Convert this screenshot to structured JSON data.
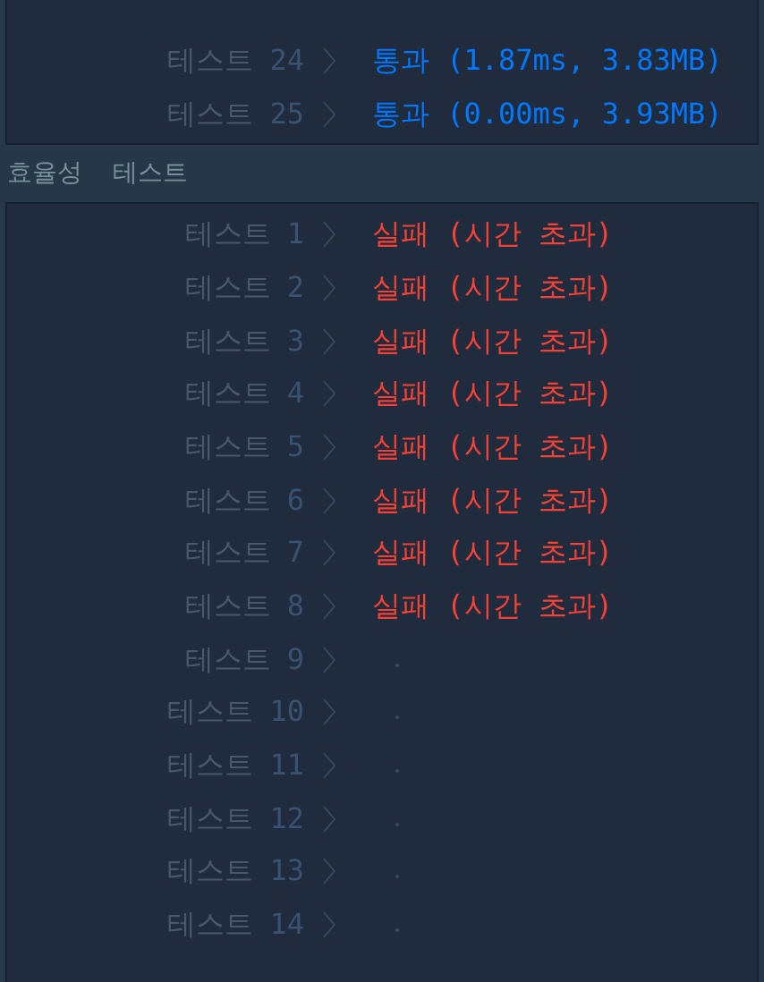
{
  "sections": [
    {
      "tests": [
        {
          "label": "테스트",
          "number": "24",
          "kind": "pass",
          "result": "통과 (1.87ms, 3.83MB)"
        },
        {
          "label": "테스트",
          "number": "25",
          "kind": "pass",
          "result": "통과 (0.00ms, 3.93MB)"
        }
      ]
    },
    {
      "title": "효율성  테스트",
      "tests": [
        {
          "label": "테스트",
          "number": "1",
          "kind": "fail",
          "result": "실패 (시간 초과)"
        },
        {
          "label": "테스트",
          "number": "2",
          "kind": "fail",
          "result": "실패 (시간 초과)"
        },
        {
          "label": "테스트",
          "number": "3",
          "kind": "fail",
          "result": "실패 (시간 초과)"
        },
        {
          "label": "테스트",
          "number": "4",
          "kind": "fail",
          "result": "실패 (시간 초과)"
        },
        {
          "label": "테스트",
          "number": "5",
          "kind": "fail",
          "result": "실패 (시간 초과)"
        },
        {
          "label": "테스트",
          "number": "6",
          "kind": "fail",
          "result": "실패 (시간 초과)"
        },
        {
          "label": "테스트",
          "number": "7",
          "kind": "fail",
          "result": "실패 (시간 초과)"
        },
        {
          "label": "테스트",
          "number": "8",
          "kind": "fail",
          "result": "실패 (시간 초과)"
        },
        {
          "label": "테스트",
          "number": "9",
          "kind": "pending"
        },
        {
          "label": "테스트",
          "number": "10",
          "kind": "pending"
        },
        {
          "label": "테스트",
          "number": "11",
          "kind": "pending"
        },
        {
          "label": "테스트",
          "number": "12",
          "kind": "pending"
        },
        {
          "label": "테스트",
          "number": "13",
          "kind": "pending"
        },
        {
          "label": "테스트",
          "number": "14",
          "kind": "pending"
        }
      ]
    }
  ]
}
